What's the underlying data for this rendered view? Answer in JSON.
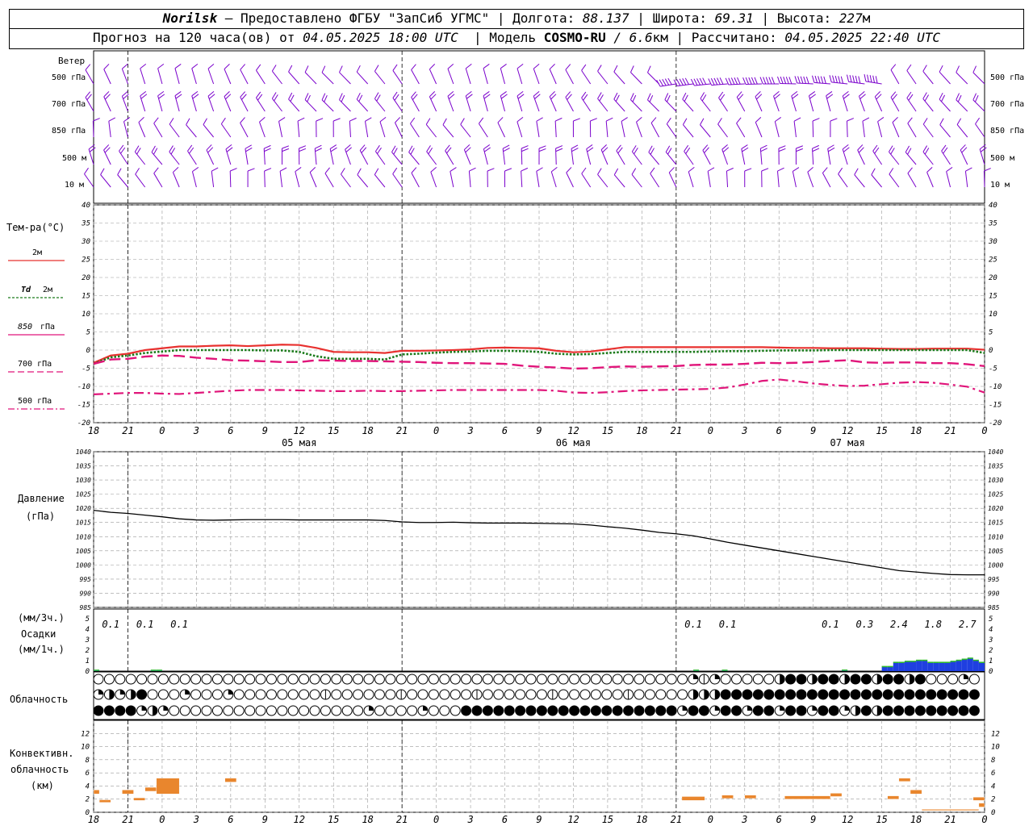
{
  "header": {
    "station": "Norilsk",
    "provider_prefix": "–",
    "provider": "Предоставлено ФГБУ \"ЗапСиб УГМС\"",
    "lon_label": "Долгота:",
    "lon_value": "88.137",
    "lat_label": "Широта:",
    "lat_value": "69.31",
    "alt_label": "Высота:",
    "alt_value": "227",
    "alt_unit": "м",
    "forecast_label": "Прогноз на 120 часа(ов) от",
    "forecast_time": "04.05.2025 18:00 UTC",
    "model_label": "Модель",
    "model_name": "COSMO-RU",
    "model_res": "/ 6.6",
    "model_res_unit": "км",
    "calc_label": "Рассчитано:",
    "calc_time": "04.05.2025 22:40 UTC"
  },
  "wind_panel": {
    "title": "Ветер",
    "levels": [
      "500 гПа",
      "700 гПа",
      "850 гПа",
      "500 м",
      "10 м"
    ],
    "color": "#7a00cc"
  },
  "temp_panel": {
    "title": "Тем-ра(°С)",
    "legend": [
      {
        "label": "2м",
        "color": "#e8312f",
        "dash": "solid"
      },
      {
        "label_it": "Td",
        "label": "2м",
        "color": "#1a7a1a",
        "dash": "dot"
      },
      {
        "label_it": "850",
        "label": "гПа",
        "color": "#e0157a",
        "dash": "solid"
      },
      {
        "label": "700 гПа",
        "color": "#e0157a",
        "dash": "dash"
      },
      {
        "label": "500 гПа",
        "color": "#e0157a",
        "dash": "dashdot"
      }
    ]
  },
  "pressure_panel": {
    "title": "Давление",
    "unit": "(гПа)"
  },
  "precip_panel": {
    "unit3": "(мм/3ч.)",
    "title": "Осадки",
    "unit1": "(мм/1ч.)"
  },
  "cloud_panel": {
    "title": "Облачность"
  },
  "conv_panel": {
    "title1": "Конвективн.",
    "title2": "облачность",
    "unit": "(км)"
  },
  "chart_data": {
    "type": "line",
    "time_ticks": [
      "18",
      "21",
      "0",
      "3",
      "6",
      "9",
      "12",
      "15",
      "18",
      "21",
      "0",
      "3",
      "6",
      "9",
      "12",
      "15",
      "18",
      "21",
      "0",
      "3",
      "6",
      "9",
      "12",
      "15",
      "18",
      "21",
      "0"
    ],
    "day_labels": [
      {
        "hour_index": 36,
        "label": "05 мая"
      },
      {
        "hour_index": 84,
        "label": "06 мая"
      },
      {
        "hour_index": 132,
        "label": "07 мая"
      }
    ],
    "hours_total": 156,
    "temperature": {
      "ylim": [
        -20,
        40
      ],
      "yticks": [
        40,
        35,
        30,
        25,
        20,
        15,
        10,
        5,
        0,
        -5,
        -10,
        -15,
        -20
      ],
      "x": [
        0,
        3,
        6,
        9,
        12,
        15,
        18,
        21,
        24,
        27,
        30,
        33,
        36,
        39,
        42,
        45,
        48,
        51,
        54,
        57,
        60,
        63,
        66,
        69,
        72,
        75,
        78,
        81,
        84,
        87,
        90,
        93,
        96,
        99,
        102,
        105,
        108,
        111,
        114,
        117,
        120,
        123,
        126,
        129,
        132,
        135,
        138,
        141,
        144,
        147,
        150,
        153,
        156
      ],
      "series": [
        {
          "name": "2м",
          "values": [
            -3.5,
            -1.5,
            -1,
            0,
            0.5,
            1,
            1,
            1.2,
            1.3,
            1.1,
            1.3,
            1.5,
            1.4,
            0.6,
            -0.5,
            -0.6,
            -0.6,
            -0.8,
            -0.2,
            -0.2,
            -0.1,
            0,
            0.2,
            0.6,
            0.7,
            0.6,
            0.5,
            -0.2,
            -0.6,
            -0.4,
            0.2,
            0.8,
            0.8,
            0.8,
            0.8,
            0.8,
            0.8,
            0.8,
            0.8,
            0.8,
            0.7,
            0.6,
            0.6,
            0.5,
            0.5,
            0.5,
            0.4,
            0.3,
            0.3,
            0.4,
            0.4,
            0.4,
            0.1
          ]
        },
        {
          "name": "Td 2м",
          "values": [
            -3.8,
            -2,
            -1.5,
            -0.8,
            -0.4,
            0,
            0,
            0,
            0,
            0,
            -0.1,
            -0.1,
            -0.5,
            -1.7,
            -2.4,
            -2.4,
            -2.4,
            -2.6,
            -1.2,
            -1,
            -0.7,
            -0.5,
            -0.4,
            -0.2,
            -0.2,
            -0.3,
            -0.5,
            -1,
            -1.2,
            -1.1,
            -0.8,
            -0.5,
            -0.5,
            -0.5,
            -0.5,
            -0.5,
            -0.4,
            -0.3,
            -0.3,
            -0.2,
            -0.1,
            -0.1,
            -0.1,
            0,
            0,
            0,
            0,
            0,
            0,
            0,
            0,
            0,
            -0.8
          ]
        },
        {
          "name": "850 гПа",
          "values": [
            -3.8,
            -2.6,
            -2.4,
            -1.8,
            -1.5,
            -1.6,
            -2.1,
            -2.4,
            -2.8,
            -2.9,
            -3.1,
            -3.3,
            -3.3,
            -2.8,
            -2.9,
            -3,
            -3,
            -3.1,
            -3.2,
            -3.3,
            -3.5,
            -3.6,
            -3.6,
            -3.7,
            -3.8,
            -4.3,
            -4.6,
            -4.8,
            -5.1,
            -5,
            -4.7,
            -4.5,
            -4.6,
            -4.5,
            -4.4,
            -4.1,
            -4,
            -4,
            -3.8,
            -3.5,
            -3.6,
            -3.5,
            -3.3,
            -3,
            -2.8,
            -3.4,
            -3.5,
            -3.4,
            -3.4,
            -3.6,
            -3.6,
            -3.9,
            -4.4
          ]
        },
        {
          "name": "700 гПа",
          "values": [
            -12.2,
            -12,
            -11.8,
            -11.8,
            -12,
            -12.1,
            -11.8,
            -11.5,
            -11.2,
            -11,
            -11,
            -11,
            -11.1,
            -11.2,
            -11.3,
            -11.3,
            -11.2,
            -11.3,
            -11.3,
            -11.2,
            -11.1,
            -11,
            -11,
            -11,
            -11,
            -11,
            -11,
            -11.2,
            -11.7,
            -11.8,
            -11.6,
            -11.3,
            -11.1,
            -11,
            -10.9,
            -10.8,
            -10.7,
            -10.3,
            -9.5,
            -8.5,
            -8.1,
            -8.6,
            -9.2,
            -9.6,
            -9.9,
            -9.8,
            -9.4,
            -9.0,
            -8.8,
            -9.0,
            -9.5,
            -10.1,
            -11.7
          ]
        }
      ]
    },
    "pressure": {
      "ylim": [
        985,
        1040
      ],
      "yticks": [
        1040,
        1035,
        1030,
        1025,
        1020,
        1015,
        1010,
        1005,
        1000,
        995,
        990,
        985
      ],
      "x": [
        0,
        3,
        6,
        9,
        12,
        15,
        18,
        21,
        24,
        27,
        30,
        33,
        36,
        39,
        42,
        45,
        48,
        51,
        54,
        57,
        60,
        63,
        66,
        69,
        72,
        75,
        78,
        81,
        84,
        87,
        90,
        93,
        96,
        99,
        102,
        105,
        108,
        111,
        114,
        117,
        120,
        123,
        126,
        129,
        132,
        135,
        138,
        141,
        144,
        147,
        150,
        153,
        156
      ],
      "values": [
        1019.3,
        1018.6,
        1018.2,
        1017.6,
        1017.0,
        1016.3,
        1015.9,
        1015.8,
        1015.9,
        1016.0,
        1016.0,
        1016.0,
        1015.9,
        1015.9,
        1015.9,
        1015.9,
        1015.9,
        1015.7,
        1015.2,
        1015.0,
        1015.0,
        1015.1,
        1014.9,
        1014.8,
        1014.8,
        1014.8,
        1014.7,
        1014.6,
        1014.5,
        1014.1,
        1013.5,
        1013.0,
        1012.3,
        1011.5,
        1011.0,
        1010.3,
        1009.2,
        1008.0,
        1007.0,
        1006.0,
        1005.0,
        1004.0,
        1003.0,
        1002.0,
        1001.0,
        1000.0,
        999.0,
        998.0,
        997.5,
        997.0,
        996.6,
        996.5,
        996.5
      ]
    },
    "precip": {
      "ylim": [
        0,
        5
      ],
      "yticks": [
        5,
        4,
        3,
        2,
        1,
        0
      ],
      "sums_3h": [
        {
          "hour": 3,
          "label": "0.1"
        },
        {
          "hour": 9,
          "label": "0.1"
        },
        {
          "hour": 15,
          "label": "0.1"
        },
        {
          "hour": 105,
          "label": "0.1"
        },
        {
          "hour": 111,
          "label": "0.1"
        },
        {
          "hour": 129,
          "label": "0.1"
        },
        {
          "hour": 135,
          "label": "0.3"
        },
        {
          "hour": 141,
          "label": "2.4"
        },
        {
          "hour": 147,
          "label": "1.8"
        },
        {
          "hour": 153,
          "label": "2.7"
        }
      ],
      "bars_1h": [
        {
          "hour": 0,
          "value": 0.05
        },
        {
          "hour": 10,
          "value": 0.05
        },
        {
          "hour": 11,
          "value": 0.05
        },
        {
          "hour": 105,
          "value": 0.05
        },
        {
          "hour": 110,
          "value": 0.05
        },
        {
          "hour": 131,
          "value": 0.06
        },
        {
          "hour": 138,
          "value": 0.4
        },
        {
          "hour": 139,
          "value": 0.4
        },
        {
          "hour": 140,
          "value": 0.8
        },
        {
          "hour": 141,
          "value": 0.8
        },
        {
          "hour": 142,
          "value": 0.9
        },
        {
          "hour": 143,
          "value": 0.9
        },
        {
          "hour": 144,
          "value": 1.0
        },
        {
          "hour": 145,
          "value": 1.0
        },
        {
          "hour": 146,
          "value": 0.8
        },
        {
          "hour": 147,
          "value": 0.8
        },
        {
          "hour": 148,
          "value": 0.8
        },
        {
          "hour": 149,
          "value": 0.8
        },
        {
          "hour": 150,
          "value": 0.9
        },
        {
          "hour": 151,
          "value": 1.0
        },
        {
          "hour": 152,
          "value": 1.1
        },
        {
          "hour": 153,
          "value": 1.2
        },
        {
          "hour": 154,
          "value": 1.0
        },
        {
          "hour": 155,
          "value": 0.8
        }
      ],
      "bar_color": "#1f3fe0",
      "bar_top_color": "#2db82d"
    },
    "conv_cloud": {
      "ylim": [
        0,
        14
      ],
      "yticks": [
        12,
        10,
        8,
        6,
        4,
        2,
        0
      ],
      "bars": [
        {
          "h0": 0,
          "h1": 1,
          "bottom": 2.8,
          "top": 3.4
        },
        {
          "h0": 1,
          "h1": 3,
          "bottom": 1.5,
          "top": 1.9
        },
        {
          "h0": 5,
          "h1": 7,
          "bottom": 2.8,
          "top": 3.4
        },
        {
          "h0": 7,
          "h1": 9,
          "bottom": 1.8,
          "top": 2.2
        },
        {
          "h0": 9,
          "h1": 11,
          "bottom": 3.2,
          "top": 3.8
        },
        {
          "h0": 11,
          "h1": 15,
          "bottom": 2.8,
          "top": 5.2
        },
        {
          "h0": 23,
          "h1": 25,
          "bottom": 4.6,
          "top": 5.2
        },
        {
          "h0": 103,
          "h1": 107,
          "bottom": 1.8,
          "top": 2.4
        },
        {
          "h0": 110,
          "h1": 112,
          "bottom": 2.1,
          "top": 2.6
        },
        {
          "h0": 114,
          "h1": 116,
          "bottom": 2.1,
          "top": 2.6
        },
        {
          "h0": 121,
          "h1": 129,
          "bottom": 2.0,
          "top": 2.5
        },
        {
          "h0": 129,
          "h1": 131,
          "bottom": 2.4,
          "top": 2.9
        },
        {
          "h0": 139,
          "h1": 141,
          "bottom": 2.0,
          "top": 2.5
        },
        {
          "h0": 141,
          "h1": 143,
          "bottom": 4.7,
          "top": 5.2
        },
        {
          "h0": 143,
          "h1": 145,
          "bottom": 2.8,
          "top": 3.4
        },
        {
          "h0": 145,
          "h1": 155,
          "bottom": 0.3,
          "top": 0.45
        },
        {
          "h0": 154,
          "h1": 156,
          "bottom": 1.8,
          "top": 2.3
        },
        {
          "h0": 155,
          "h1": 156,
          "bottom": 0.8,
          "top": 1.4
        }
      ],
      "color": "#e9862d"
    }
  }
}
